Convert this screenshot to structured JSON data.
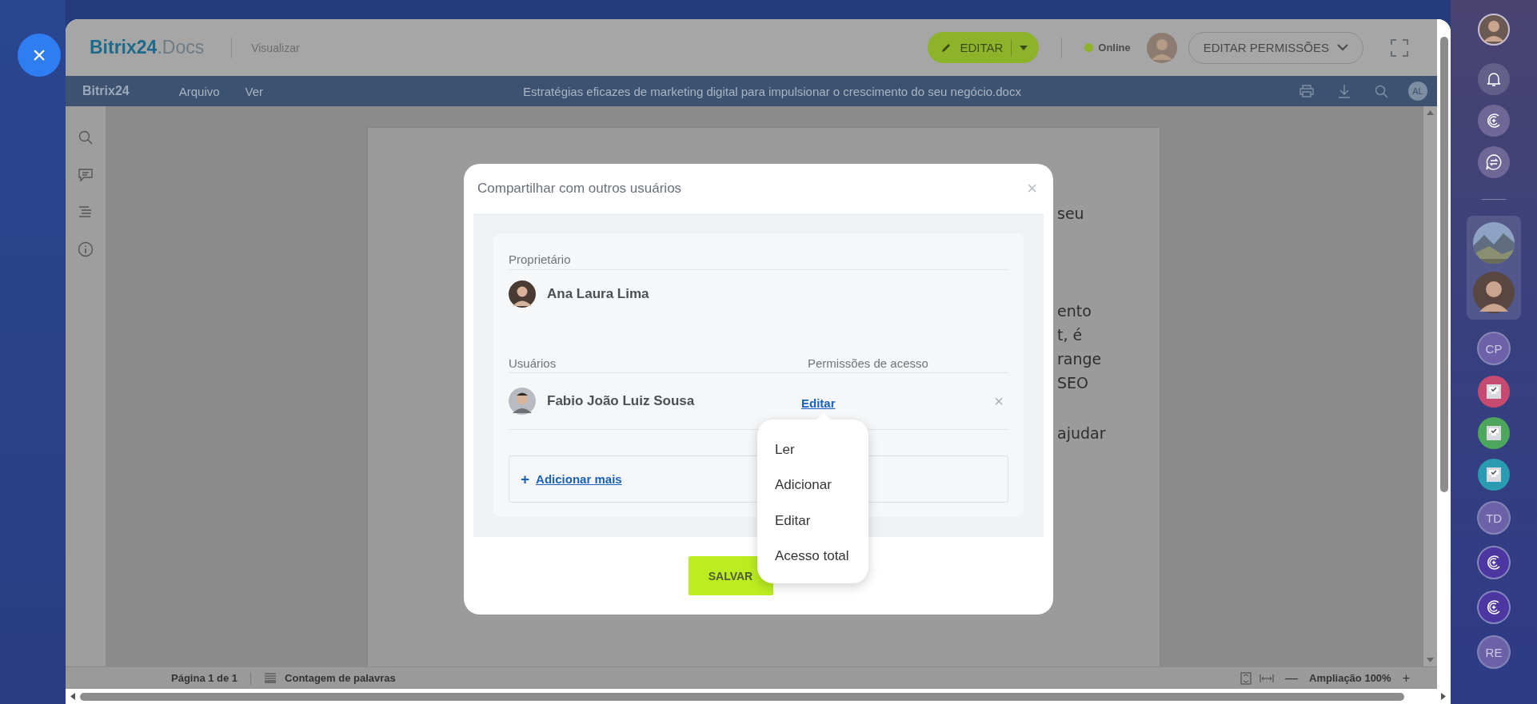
{
  "close_button": {
    "label": "×"
  },
  "header": {
    "logo_main": "Bitrix24",
    "logo_sub": ".Docs",
    "mode": "Visualizar",
    "edit_button": "EDITAR",
    "status": "Online",
    "status_online": true,
    "permissions_button": "EDITAR PERMISSÕES"
  },
  "toolbar": {
    "logo": "Bitrix24",
    "menus": [
      "Arquivo",
      "Ver"
    ],
    "document_title": "Estratégias eficazes de marketing digital para impulsionar o crescimento do seu negócio.docx",
    "user_initials": "AL"
  },
  "document": {
    "paragraphs": [
      [
        "seu"
      ],
      [
        "ento",
        "t, é",
        "range",
        "SEO"
      ],
      [
        "ajudar"
      ]
    ]
  },
  "status_bar": {
    "page": "Página 1 de 1",
    "word_count": "Contagem de palavras",
    "zoom_minus": "—",
    "zoom": "Ampliação 100%",
    "zoom_plus": "+"
  },
  "dialog": {
    "title": "Compartilhar com outros usuários",
    "close": "×",
    "owner_label": "Proprietário",
    "owner_name": "Ana Laura Lima",
    "users_label": "Usuários",
    "permissions_label": "Permissões de acesso",
    "users": [
      {
        "name": "Fabio João Luiz Sousa",
        "permission": "Editar",
        "remove": "×"
      }
    ],
    "add_more_icon": "+",
    "add_more": "Adicionar mais",
    "save_button": "SALVAR"
  },
  "permission_menu": {
    "items": [
      "Ler",
      "Adicionar",
      "Editar",
      "Acesso total"
    ]
  },
  "right_sidebar": {
    "items": [
      {
        "kind": "avatar"
      },
      {
        "kind": "bell"
      },
      {
        "kind": "copilot",
        "color": "#6f6796"
      },
      {
        "kind": "chat",
        "color": "#6f6796"
      },
      {
        "kind": "divider"
      },
      {
        "kind": "group"
      },
      {
        "kind": "initials",
        "text": "CP",
        "color": "#6d62a8"
      },
      {
        "kind": "task",
        "color": "#c64a72"
      },
      {
        "kind": "task",
        "color": "#4ca65c"
      },
      {
        "kind": "task",
        "color": "#2a9bb0"
      },
      {
        "kind": "initials",
        "text": "TD",
        "color": "#6d62a8"
      },
      {
        "kind": "copilot",
        "color": "#4b36a2"
      },
      {
        "kind": "copilot",
        "color": "#4b36a2"
      },
      {
        "kind": "initials",
        "text": "RE",
        "color": "#6d62a8"
      }
    ]
  }
}
